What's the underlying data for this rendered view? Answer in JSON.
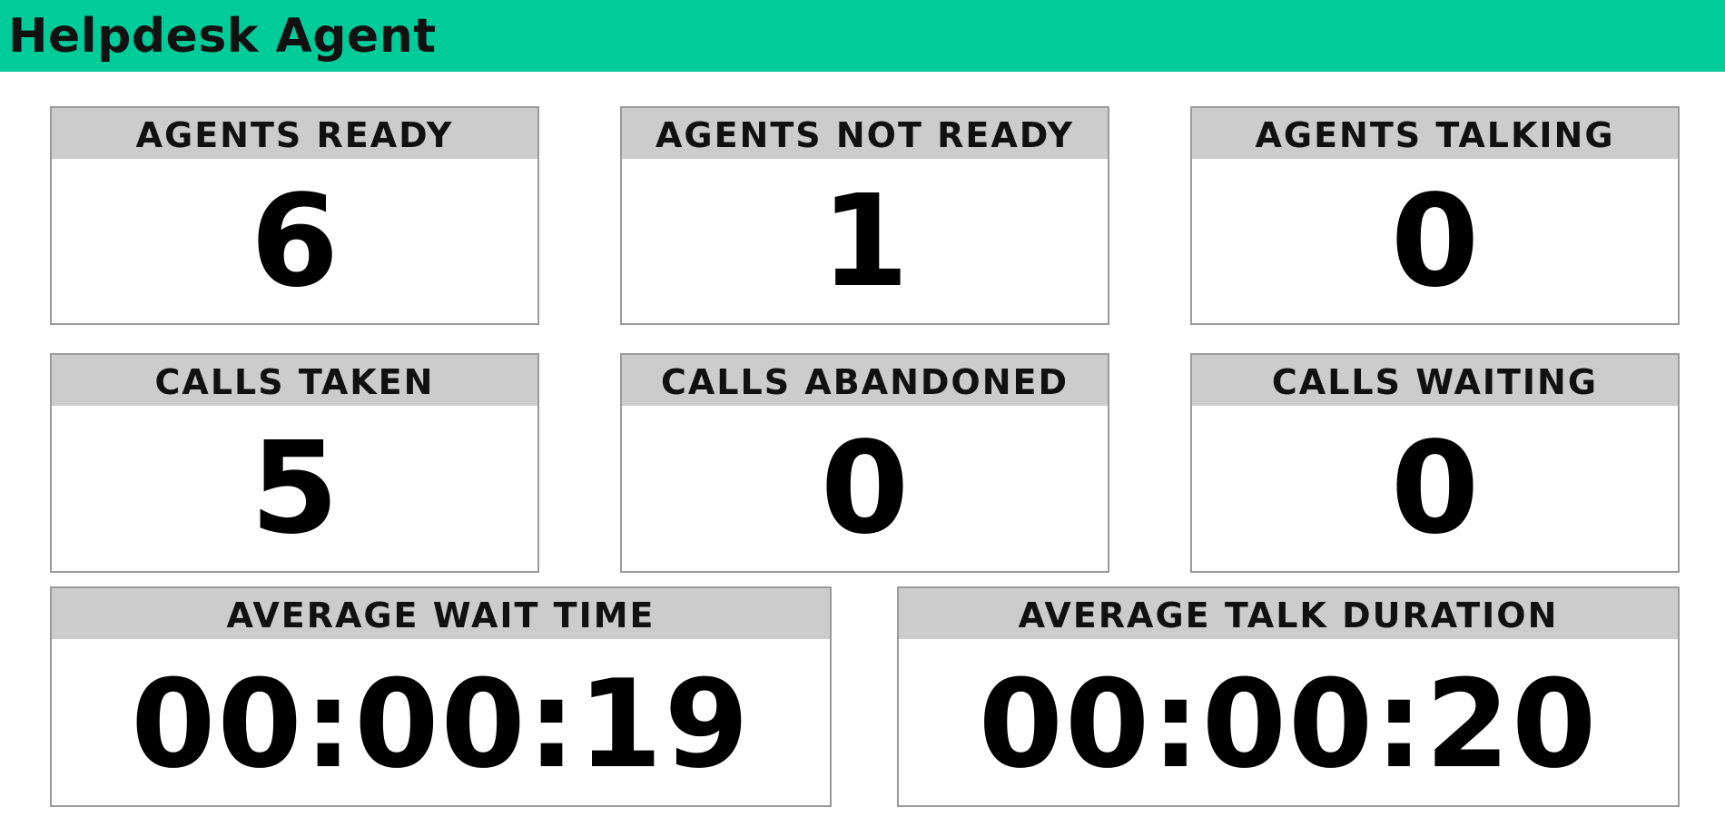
{
  "header": {
    "title": "Helpdesk Agent"
  },
  "colors": {
    "header_background": "#00cc99",
    "card_header_background": "#cccccc",
    "card_border": "#9a9a9a",
    "value_text": "#000000"
  },
  "stats": [
    {
      "label": "AGENTS READY",
      "value": "6"
    },
    {
      "label": "AGENTS NOT READY",
      "value": "1"
    },
    {
      "label": "AGENTS TALKING",
      "value": "0"
    },
    {
      "label": "CALLS TAKEN",
      "value": "5"
    },
    {
      "label": "CALLS ABANDONED",
      "value": "0"
    },
    {
      "label": "CALLS WAITING",
      "value": "0"
    }
  ],
  "times": [
    {
      "label": "AVERAGE WAIT TIME",
      "value": "00:00:19"
    },
    {
      "label": "AVERAGE TALK DURATION",
      "value": "00:00:20"
    }
  ]
}
